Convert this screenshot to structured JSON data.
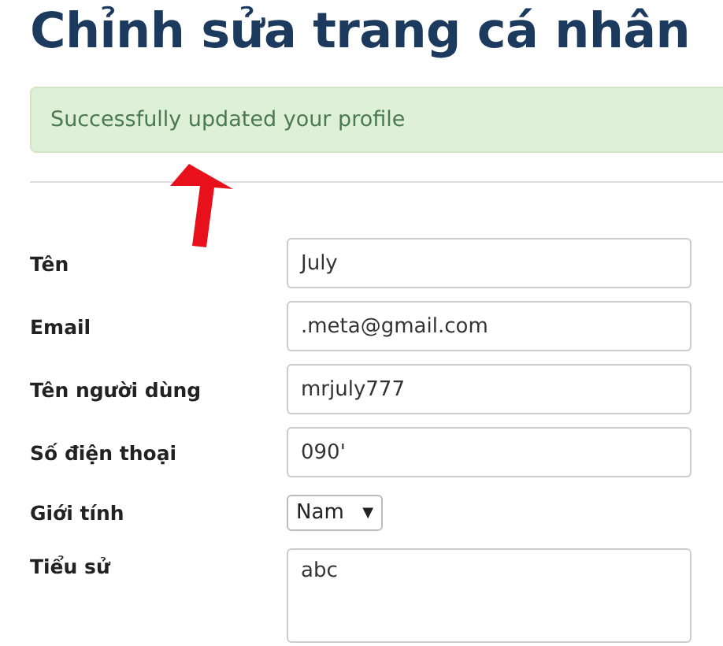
{
  "title": "Chỉnh sửa trang cá nhân",
  "alert": {
    "text": "Successfully updated your profile"
  },
  "fields": [
    {
      "label": "Tên",
      "kind": "text",
      "value": "July"
    },
    {
      "label": "Email",
      "kind": "text",
      "value": ".meta@gmail.com"
    },
    {
      "label": "Tên người dùng",
      "kind": "text",
      "value": "mrjuly777"
    },
    {
      "label": "Số điện thoại",
      "kind": "text",
      "value": "090'"
    },
    {
      "label": "Giới tính",
      "kind": "select",
      "value": "Nam",
      "caret": "▼"
    },
    {
      "label": "Tiểu sử",
      "kind": "textarea",
      "value": "abc"
    }
  ]
}
